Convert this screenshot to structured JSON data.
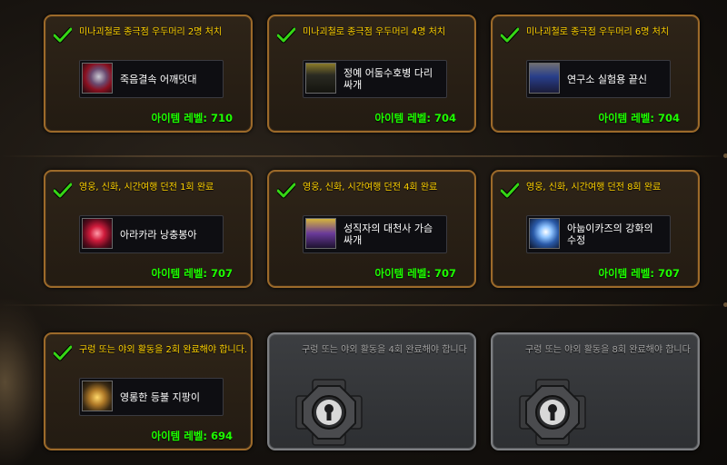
{
  "colors": {
    "requirement": "#ffd200",
    "item_level": "#1eff00",
    "frame": "#9c6a2a",
    "locked_frame": "#7d7f82"
  },
  "rewards": [
    {
      "requirement": "미나괴철로 종극점 우두머리 2명 처치",
      "item_name": "죽음결속 어깨덧대",
      "item_level_text": "아이템 레벨: 710",
      "icon": "shoulder-armor-icon",
      "unlocked": true
    },
    {
      "requirement": "미나괴철로 종극점 우두머리 4명 처치",
      "item_name": "정예 어둠수호병 다리싸개",
      "item_level_text": "아이템 레벨: 704",
      "icon": "leg-armor-icon",
      "unlocked": true
    },
    {
      "requirement": "미나괴철로 종극점 우두머리 6명 처치",
      "item_name": "연구소 실험용 끝신",
      "item_level_text": "아이템 레벨: 704",
      "icon": "boots-icon",
      "unlocked": true
    },
    {
      "requirement": "영웅, 신화, 시간여행 던전 1회 완료",
      "item_name": "아라카라 낭충봉아",
      "item_level_text": "아이템 레벨: 707",
      "icon": "trinket-orb-icon",
      "unlocked": true
    },
    {
      "requirement": "영웅, 신화, 시간여행 던전 4회 완료",
      "item_name": "성직자의 대천사 가슴싸개",
      "item_level_text": "아이템 레벨: 707",
      "icon": "chest-armor-icon",
      "unlocked": true
    },
    {
      "requirement": "영웅, 신화, 시간여행 던전 8회 완료",
      "item_name": "아눕이카즈의 강화의 수정",
      "item_level_text": "아이템 레벨: 707",
      "icon": "crystal-icon",
      "unlocked": true
    },
    {
      "requirement": "구렁 또는 야외 활동을 2회 완료해야 합니다.",
      "item_name": "영롱한 등불 지팡이",
      "item_level_text": "아이템 레벨: 694",
      "icon": "lantern-staff-icon",
      "unlocked": true
    },
    {
      "requirement": "구렁 또는 야외 활동을 4회 완료해야 합니다",
      "icon": "padlock-icon",
      "unlocked": false
    },
    {
      "requirement": "구렁 또는 야외 활동을 8회 완료해야 합니다",
      "icon": "padlock-icon",
      "unlocked": false
    }
  ]
}
